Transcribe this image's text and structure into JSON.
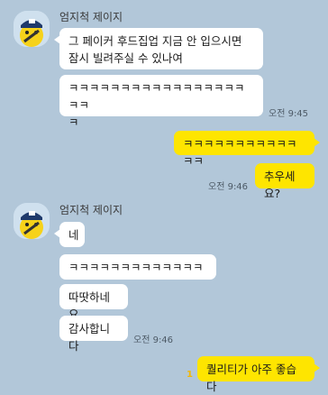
{
  "chat": {
    "sender_name": "엄지척 제이지",
    "group1": {
      "messages": [
        "그 페이커 후드집업 지금 안 입으시면\n잠시 빌려주실 수 있나여",
        "ㅋㅋㅋㅋㅋㅋㅋㅋㅋㅋㅋㅋㅋㅋㅋㅋㅋㅋㅋ\nㅋ"
      ],
      "time": "오전 9:45"
    },
    "mine1": {
      "messages": [
        "ㅋㅋㅋㅋㅋㅋㅋㅋㅋㅋㅋㅋㅋ",
        "추우세요?"
      ],
      "time": "오전 9:46"
    },
    "group2": {
      "messages": [
        "네",
        "ㅋㅋㅋㅋㅋㅋㅋㅋㅋㅋㅋㅋㅋ",
        "따땃하네요",
        "감사합니다"
      ],
      "time": "오전 9:46"
    },
    "mine2": {
      "message": "퀄리티가 아주 좋습다",
      "unread": "1"
    }
  },
  "colors": {
    "background": "#b2c7d9",
    "my_bubble": "#fee500",
    "their_bubble": "#ffffff"
  },
  "icons": {
    "avatar": "cartoon-character-avatar-icon"
  }
}
